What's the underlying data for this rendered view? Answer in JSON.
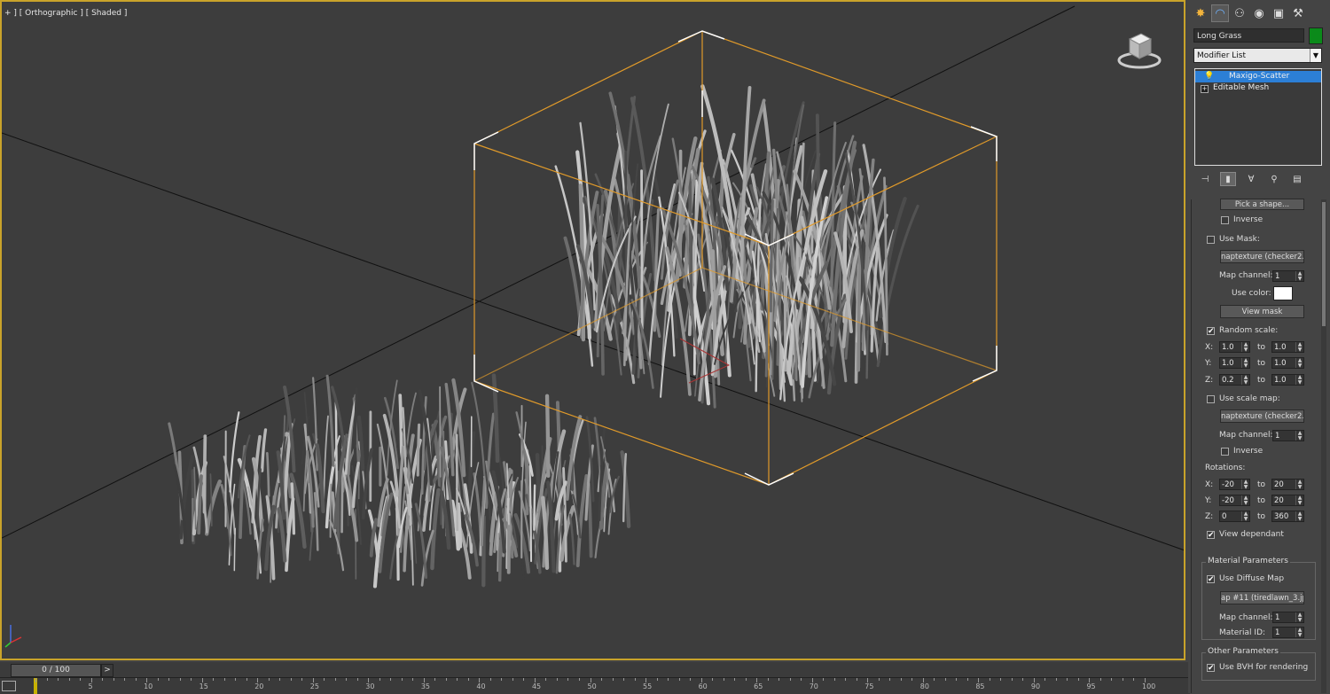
{
  "viewport": {
    "label": "+ ] [ Orthographic ] [ Shaded ]"
  },
  "timeline": {
    "frame_label": "0 / 100",
    "prev_label": "<",
    "next_label": ">",
    "ticks": [
      "5",
      "10",
      "15",
      "20",
      "25",
      "30",
      "35",
      "40",
      "45",
      "50",
      "55",
      "60",
      "65",
      "70",
      "75",
      "80",
      "85",
      "90",
      "95",
      "100"
    ]
  },
  "panel": {
    "tabs": [
      "create-icon",
      "modify-icon",
      "hierarchy-icon",
      "motion-icon",
      "display-icon",
      "utilities-icon"
    ],
    "object_name": "Long Grass",
    "object_color": "#0b8a1a",
    "modifier_list": "Modifier List",
    "stack": {
      "selected": "Maxigo-Scatter",
      "base": "Editable Mesh"
    },
    "pick_shape": "Pick a shape...",
    "inverse_1": "Inverse",
    "use_mask": "Use Mask:",
    "mask_map": "naptexture (checker2.j",
    "map_channel_label": "Map channel:",
    "map_channel_1": "1",
    "use_color": "Use color:",
    "view_mask": "View mask",
    "random_scale": "Random scale:",
    "to_label": "to",
    "scale": {
      "x_label": "X:",
      "x_from": "1.0",
      "x_to": "1.0",
      "y_label": "Y:",
      "y_from": "1.0",
      "y_to": "1.0",
      "z_label": "Z:",
      "z_from": "0.2",
      "z_to": "1.0"
    },
    "use_scale_map": "Use scale map:",
    "scale_map": "naptexture (checker2.j",
    "map_channel_2": "1",
    "inverse_2": "Inverse",
    "rotations": "Rotations:",
    "rot": {
      "x_label": "X:",
      "x_from": "-20",
      "x_to": "20",
      "y_label": "Y:",
      "y_from": "-20",
      "y_to": "20",
      "z_label": "Z:",
      "z_from": "0",
      "z_to": "360"
    },
    "view_dependant": "View dependant",
    "material_title": "Material Parameters",
    "use_diffuse": "Use Diffuse Map",
    "diffuse_map": "ap #11 (tiredlawn_3.jp",
    "mat_map_channel": "1",
    "material_id_label": "Material ID:",
    "material_id": "1",
    "other_title": "Other Parameters",
    "use_bvh": "Use BVH for rendering"
  }
}
